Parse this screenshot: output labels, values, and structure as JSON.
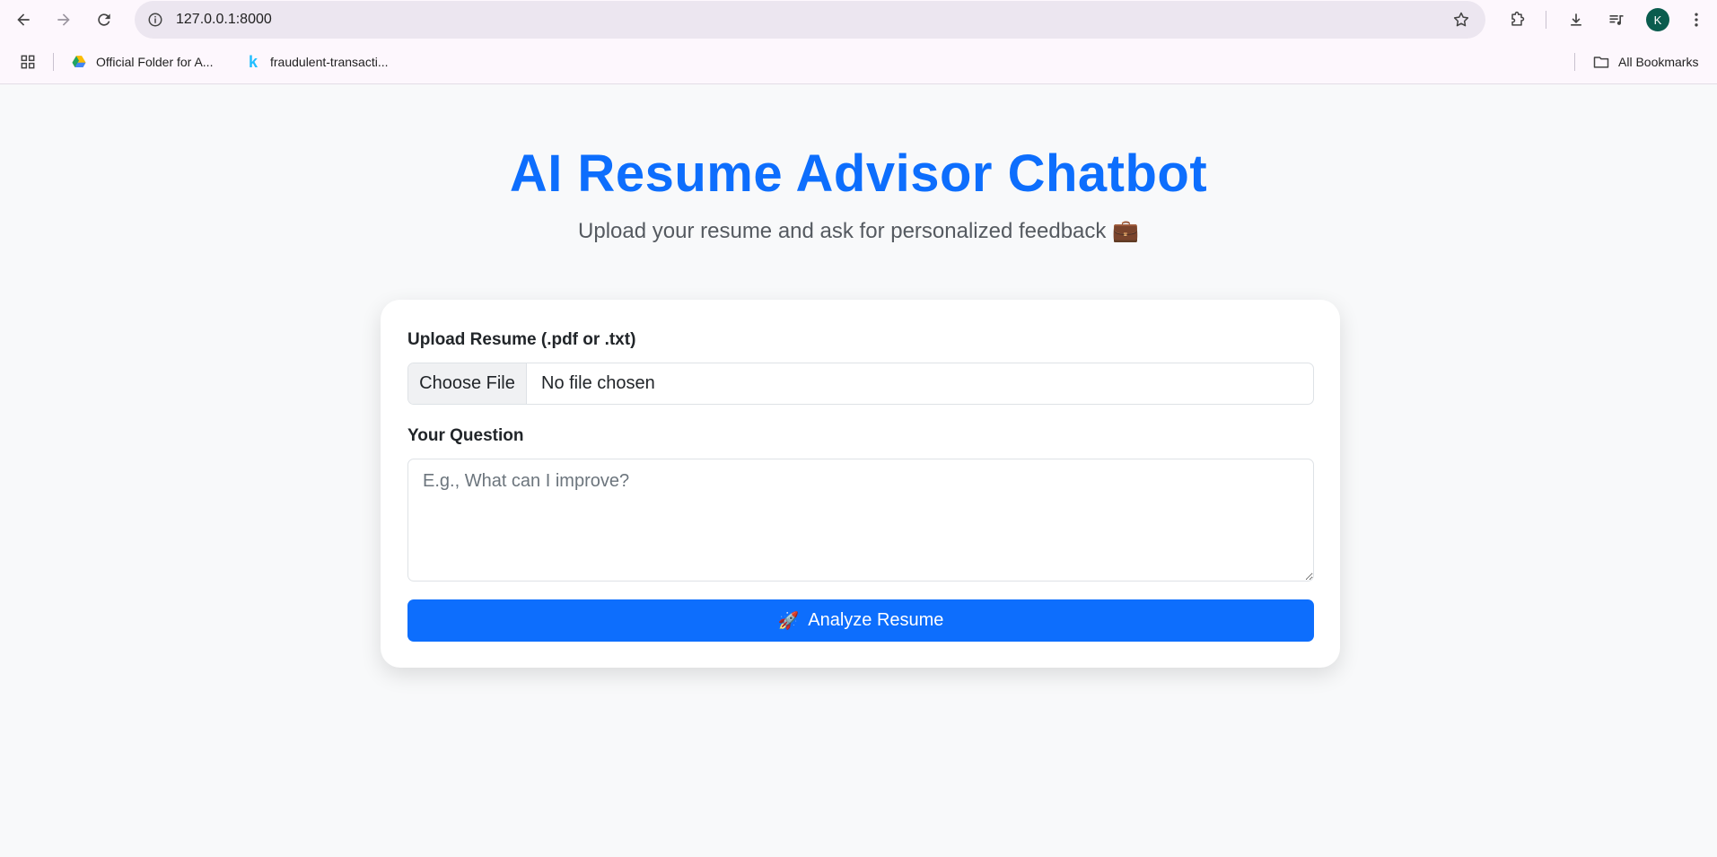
{
  "browser": {
    "url": "127.0.0.1:8000",
    "avatar_letter": "K",
    "bookmarks": [
      {
        "label": "Official Folder for A...",
        "icon": "google-drive-icon"
      },
      {
        "label": "fraudulent-transacti...",
        "icon": "kaggle-icon"
      }
    ],
    "all_bookmarks_label": "All Bookmarks"
  },
  "page": {
    "title": "AI Resume Advisor Chatbot",
    "subtitle": "Upload your resume and ask for personalized feedback 💼"
  },
  "form": {
    "upload_label": "Upload Resume (.pdf or .txt)",
    "choose_file_label": "Choose File",
    "file_status": "No file chosen",
    "question_label": "Your Question",
    "question_placeholder": "E.g., What can I improve?",
    "submit_icon": "🚀",
    "submit_label": "Analyze Resume"
  },
  "colors": {
    "accent": "#0d6efd",
    "page_background": "#f8f9fa",
    "browser_chrome": "#fdf7fd"
  }
}
